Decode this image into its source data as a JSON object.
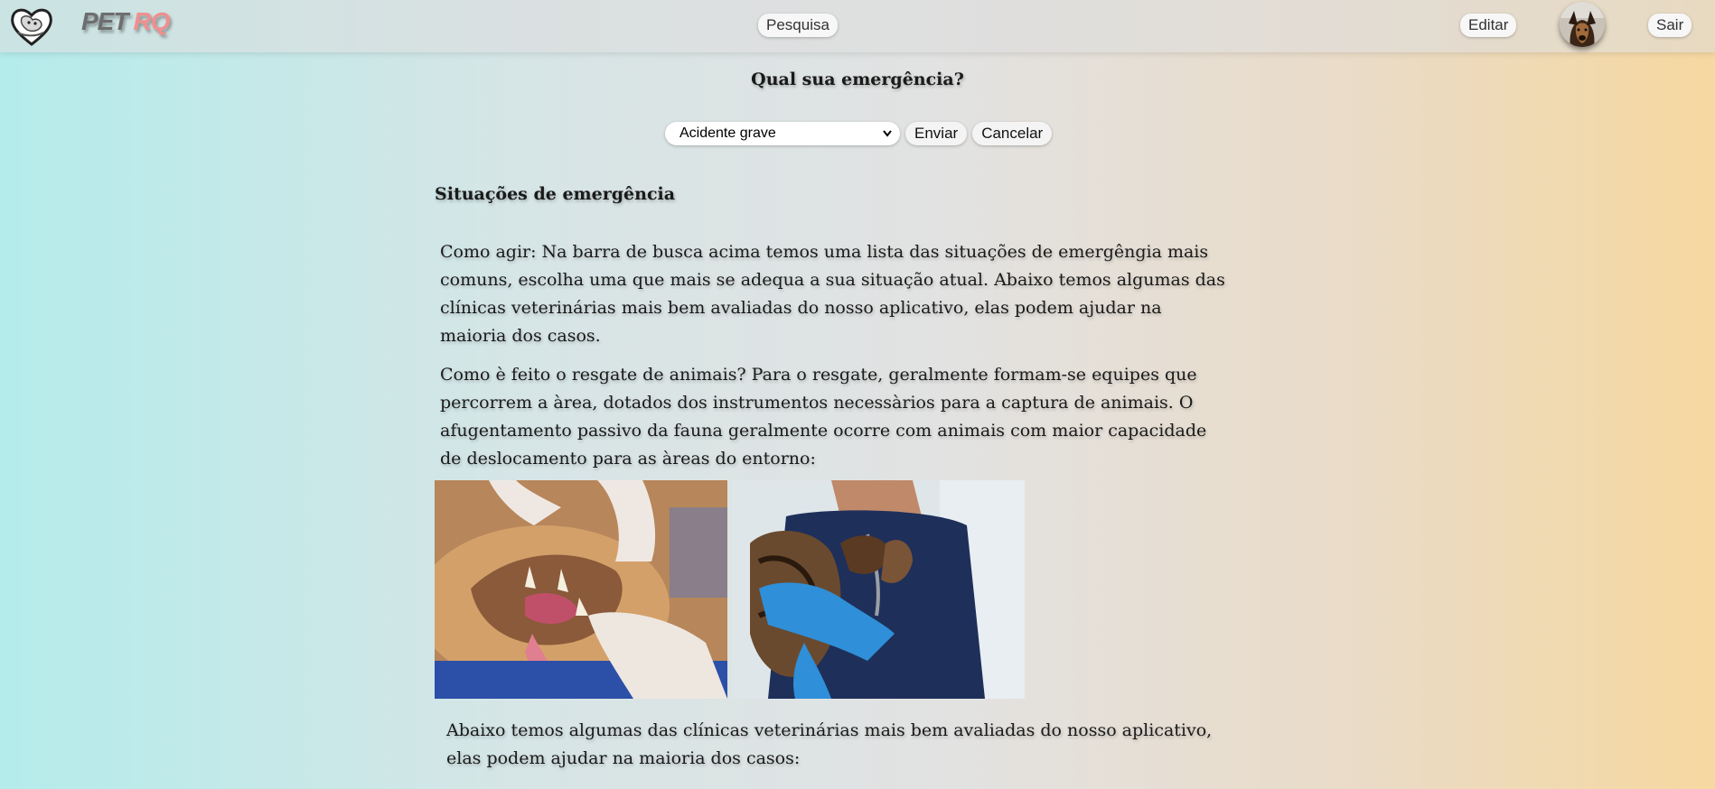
{
  "header": {
    "brand_part1": "PET",
    "brand_part2": "RQ",
    "search_label": "Pesquisa",
    "edit_label": "Editar",
    "exit_label": "Sair"
  },
  "emergency": {
    "question": "Qual sua emergência?",
    "selected_option": "Acidente grave",
    "send_label": "Enviar",
    "cancel_label": "Cancelar"
  },
  "content": {
    "section_title": "Situações de emergência",
    "paragraph1": "Como agir: Na barra de busca acima temos uma lista das situações de emergêngia mais comuns, escolha uma que mais se adequa a sua situação atual. Abaixo temos algumas das clínicas veterinárias mais bem avaliadas do nosso aplicativo, elas podem ajudar na maioria dos casos.",
    "paragraph2": "Como è feito o resgate de animais? Para o resgate, geralmente formam-se equipes que percorrem a àrea, dotados dos instrumentos necessàrios para a captura de animais. O afugentamento passivo da fauna geralmente ocorre com animais com maior capacidade de deslocamento para as àreas do entorno:",
    "paragraph3": "Abaixo temos algumas das clínicas veterinárias mais bem avaliadas do nosso aplicativo, elas podem ajudar na maioria dos casos:"
  },
  "icons": {
    "logo": "heart-pet-logo-icon",
    "avatar": "dog-avatar",
    "dropdown": "chevron-down-icon"
  },
  "colors": {
    "gradient_left": "#b4eceb",
    "gradient_right": "#f6d8a0",
    "brand_accent": "#f08f8f"
  }
}
